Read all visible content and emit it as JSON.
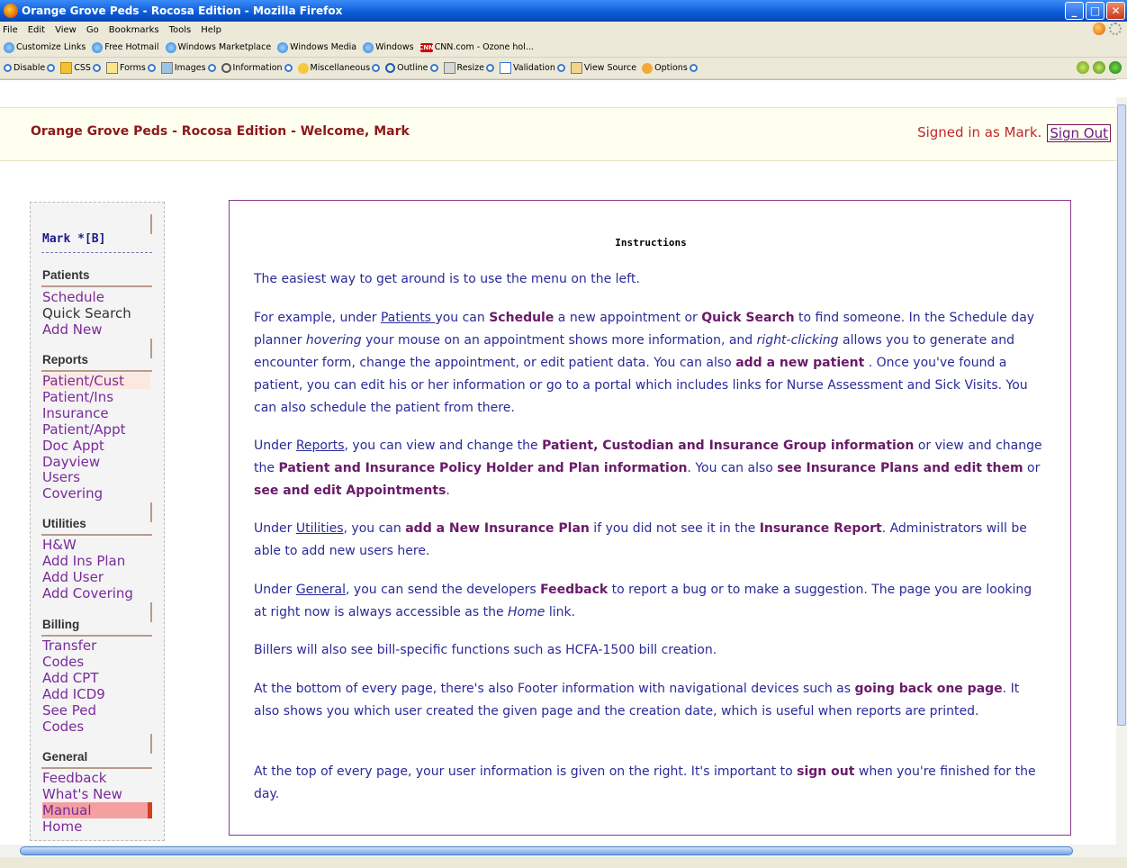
{
  "window": {
    "title": "Orange Grove Peds - Rocosa Edition - Mozilla Firefox",
    "buttons": [
      "_",
      "□",
      "✕"
    ]
  },
  "menubar": [
    "File",
    "Edit",
    "View",
    "Go",
    "Bookmarks",
    "Tools",
    "Help"
  ],
  "bookmarks": [
    {
      "label": "Customize Links",
      "icon": "bulb-icon"
    },
    {
      "label": "Free Hotmail",
      "icon": "bulb-icon"
    },
    {
      "label": "Windows Marketplace",
      "icon": "bulb-icon"
    },
    {
      "label": "Windows Media",
      "icon": "bulb-icon"
    },
    {
      "label": "Windows",
      "icon": "bulb-icon"
    },
    {
      "label": "CNN.com - Ozone hol...",
      "icon": "cnn-icon"
    }
  ],
  "devtoolbar": [
    "Disable",
    "CSS",
    "Forms",
    "Images",
    "Information",
    "Miscellaneous",
    "Outline",
    "Resize",
    "Validation",
    "View Source",
    "Options"
  ],
  "banner": {
    "title": "Orange Grove Peds - Rocosa Edition - Welcome, Mark",
    "signed_in": "Signed in as Mark.",
    "sign_out": "Sign Out"
  },
  "sidebar": {
    "user": "Mark *[B]",
    "sections": {
      "patients": {
        "title": "Patients",
        "items": [
          "Schedule",
          "Quick Search",
          "Add New"
        ]
      },
      "reports": {
        "title": "Reports",
        "items": [
          "Patient/Cust",
          "Patient/Ins",
          "Insurance",
          "Patient/Appt",
          "Doc Appt",
          "Dayview",
          "Users",
          "Covering"
        ]
      },
      "utilities": {
        "title": "Utilities",
        "items": [
          "H&W",
          "Add Ins Plan",
          "Add User",
          "Add Covering"
        ]
      },
      "billing": {
        "title": "Billing",
        "items": [
          "Transfer",
          "Codes",
          "Add CPT",
          "Add ICD9",
          "See Ped",
          "Codes"
        ]
      },
      "general": {
        "title": "General",
        "items": [
          "Feedback",
          "What's New",
          "Manual",
          "Home"
        ]
      }
    }
  },
  "content": {
    "heading": "Instructions",
    "p1": "The easiest way to get around is to use the menu on the left.",
    "p2": {
      "a": "For example, under ",
      "patients": "Patients ",
      "b": "you can ",
      "schedule": "Schedule",
      "c": " a new appointment or ",
      "quick_search": "Quick Search",
      "d": " to find someone. In the Schedule day planner ",
      "hovering": "hovering",
      "e": " your mouse on an appointment shows more information, and ",
      "right_clicking": "right-clicking",
      "f": " allows you to generate and encounter form, change the appointment, or edit patient data. You can also ",
      "add_patient": "add a new patient",
      "g": " . Once you've found a patient, you can edit his or her information or go to a portal which includes links for Nurse Assessment and Sick Visits. You can also schedule the patient from there."
    },
    "p3": {
      "a": "Under ",
      "reports": "Reports",
      "b": ", you can view and change the ",
      "pcig": "Patient, Custodian and Insurance Group information",
      "c": " or view and change the ",
      "pipp": "Patient and Insurance Policy Holder and Plan information",
      "d": ". You can also ",
      "see_ins": "see Insurance Plans and edit them",
      "e": " or ",
      "see_appt": "see and edit Appointments",
      "f": "."
    },
    "p4": {
      "a": "Under ",
      "utilities": "Utilities",
      "b": ", you can ",
      "new_plan": "add a New Insurance Plan",
      "c": " if you did not see it in the ",
      "ins_report": "Insurance Report",
      "d": ". Administrators will be able to add new users here."
    },
    "p5": {
      "a": "Under ",
      "general": "General",
      "b": ", you can send the developers ",
      "feedback": "Feedback",
      "c": " to report a bug or to make a suggestion. The page you are looking at right now is always accessible as the ",
      "home": "Home",
      "d": " link."
    },
    "p6": "Billers will also see bill-specific functions such as HCFA-1500 bill creation.",
    "p7": {
      "a": "At the bottom of every page, there's also Footer information with navigational devices such as ",
      "back": "going back one page",
      "b": ". It also shows you which user created the given page and the creation date, which is useful when reports are printed."
    },
    "p8": {
      "a": "At the top of every page, your user information is given on the right. It's important to ",
      "sign_out": "sign out",
      "b": " when you're finished for the day."
    }
  },
  "colors": {
    "banner_title": "#8b1a1a",
    "link": "#7a2a9a",
    "body_text": "#2a2a9a",
    "highlight": "#f4a0a0",
    "content_border": "#8b3a8b"
  }
}
